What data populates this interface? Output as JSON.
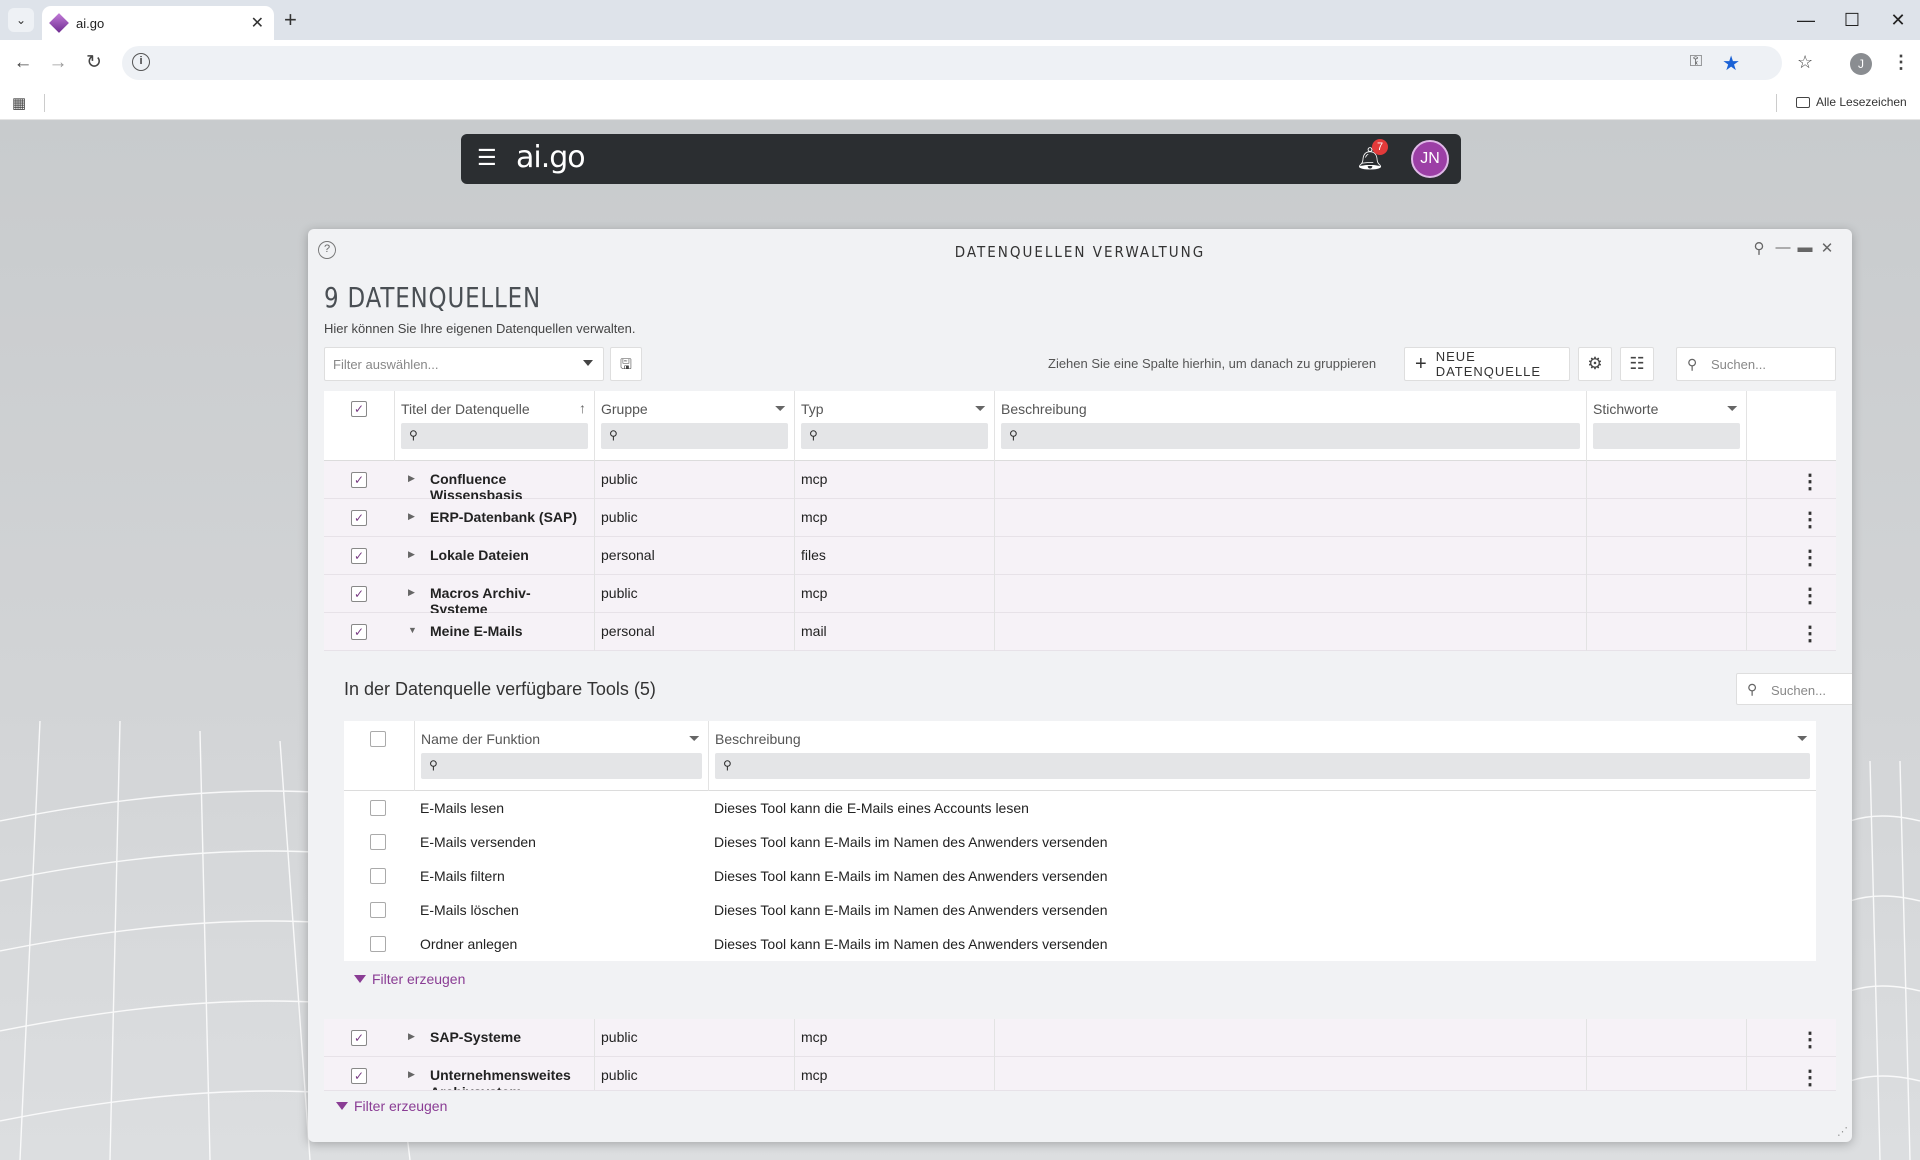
{
  "browser": {
    "tab_title": "ai.go",
    "bookmarks_all": "Alle Lesezeichen",
    "profile_initial": "J"
  },
  "app": {
    "logo": "ai.go",
    "notifications_count": "7",
    "user_initials": "JN"
  },
  "modal": {
    "title": "DATENQUELLEN VERWALTUNG",
    "heading": "9 DATENQUELLEN",
    "subtext": "Hier können Sie Ihre eigenen Datenquellen verwalten.",
    "filter_placeholder": "Filter auswählen...",
    "group_hint": "Ziehen Sie eine Spalte hierhin, um danach zu gruppieren",
    "new_button": "NEUE DATENQUELLE",
    "search_placeholder": "Suchen...",
    "columns": {
      "title": "Titel der Datenquelle",
      "group": "Gruppe",
      "type": "Typ",
      "description": "Beschreibung",
      "keywords": "Stichworte"
    },
    "rows_top": [
      {
        "title": "Confluence Wissensbasis",
        "group": "public",
        "type": "mcp"
      },
      {
        "title": "ERP-Datenbank (SAP)",
        "group": "public",
        "type": "mcp"
      },
      {
        "title": "Lokale Dateien",
        "group": "personal",
        "type": "files"
      },
      {
        "title": "Macros Archiv-Systeme",
        "group": "public",
        "type": "mcp"
      },
      {
        "title": "Meine E-Mails",
        "group": "personal",
        "type": "mail"
      }
    ],
    "detail": {
      "title": "In der Datenquelle verfügbare Tools (5)",
      "search_placeholder": "Suchen...",
      "col_function": "Name der Funktion",
      "col_description": "Beschreibung",
      "tools": [
        {
          "name": "E-Mails lesen",
          "desc": "Dieses Tool kann die E-Mails eines Accounts lesen"
        },
        {
          "name": "E-Mails versenden",
          "desc": "Dieses Tool kann E-Mails im Namen des Anwenders versenden"
        },
        {
          "name": "E-Mails filtern",
          "desc": "Dieses Tool kann E-Mails im Namen des Anwenders versenden"
        },
        {
          "name": "E-Mails löschen",
          "desc": "Dieses Tool kann E-Mails im Namen des Anwenders versenden"
        },
        {
          "name": "Ordner anlegen",
          "desc": "Dieses Tool kann E-Mails im Namen des Anwenders versenden"
        }
      ],
      "filter_link": "Filter erzeugen"
    },
    "rows_bottom": [
      {
        "title": "SAP-Systeme",
        "group": "public",
        "type": "mcp"
      },
      {
        "title": "Unternehmensweites Archivsystem",
        "group": "public",
        "type": "mcp"
      }
    ],
    "filter_link": "Filter erzeugen"
  },
  "colors": {
    "accent": "#8a3d94",
    "appbar": "#2b2e31",
    "badge": "#e23a3a"
  }
}
